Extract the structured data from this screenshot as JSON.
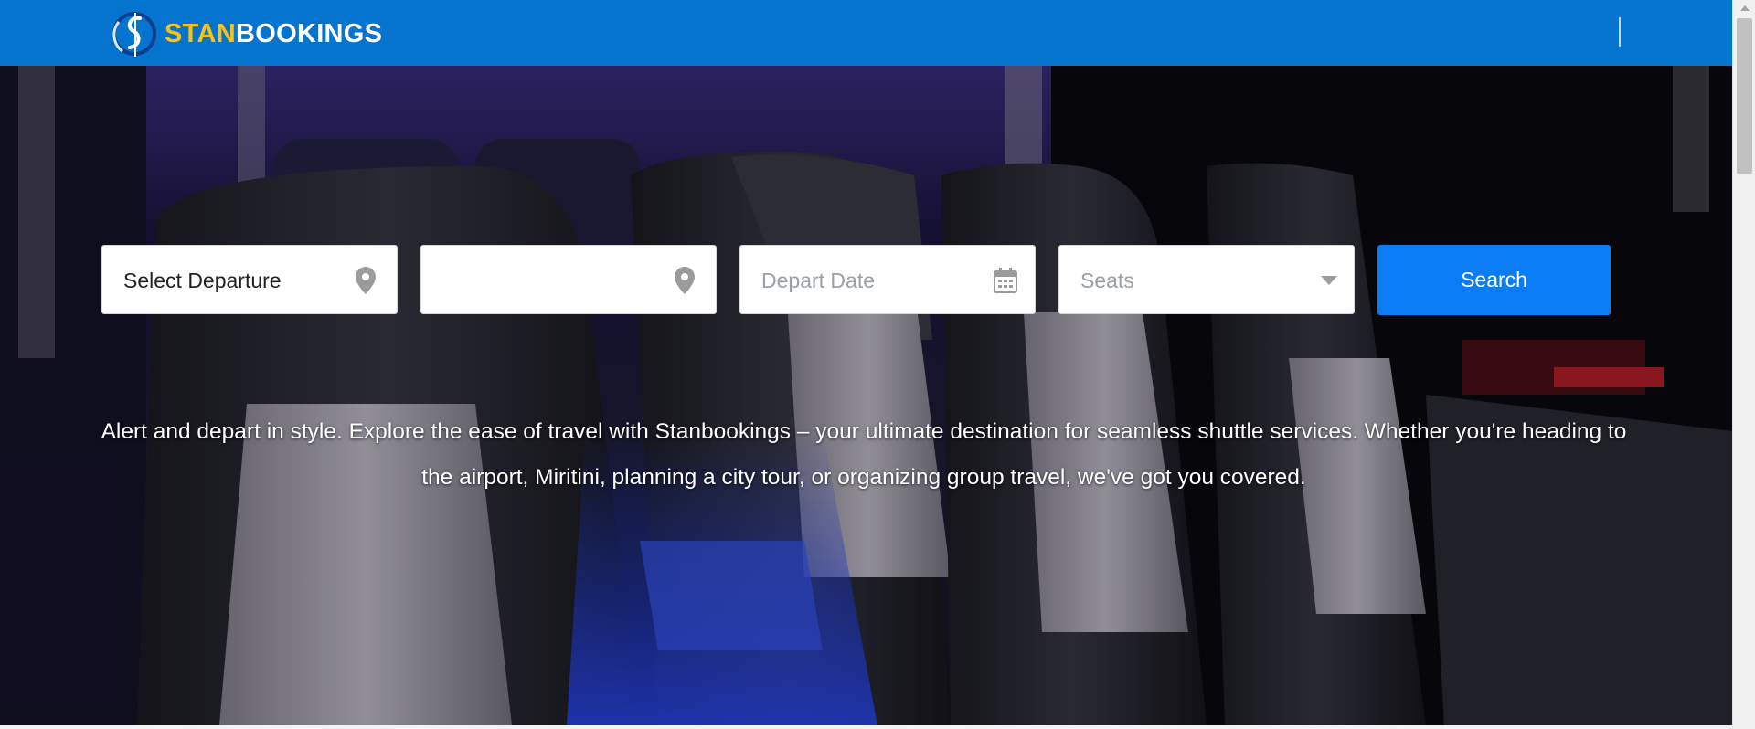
{
  "brand": {
    "part1": "STAN",
    "part2": "BOOKINGS"
  },
  "search": {
    "departure_value": "Select Departure",
    "destination_value": "",
    "date_placeholder": "Depart Date",
    "seats_value": "Seats",
    "button_label": "Search"
  },
  "hero": {
    "tagline": "Alert and depart in style. Explore the ease of travel with Stanbookings – your ultimate destination for seamless shuttle services. Whether you're heading to the airport, Miritini, planning a city tour, or organizing group travel, we've got you covered."
  },
  "colors": {
    "navbar": "#0474cf",
    "accent_yellow": "#f5c21b",
    "button": "#0a7cf4"
  },
  "icons": {
    "departure": "map-marker-icon",
    "destination": "map-marker-icon",
    "date": "calendar-icon",
    "seats": "caret-down-icon"
  }
}
